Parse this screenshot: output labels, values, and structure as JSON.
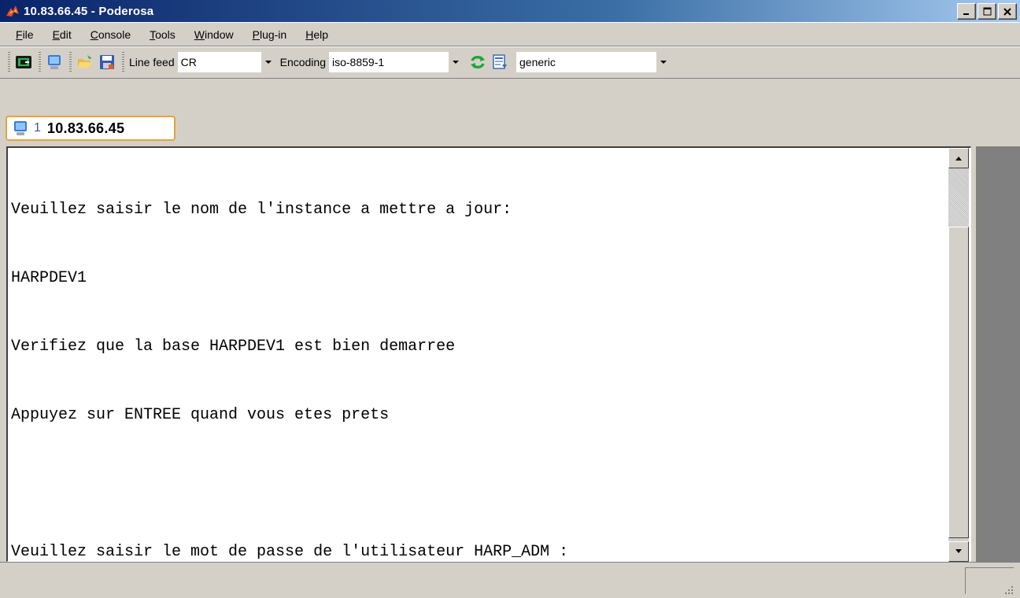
{
  "window": {
    "title": "10.83.66.45 - Poderosa",
    "app_icon": "poderosa-icon",
    "controls": [
      "minimize",
      "maximize",
      "close"
    ]
  },
  "menu": {
    "items": [
      {
        "label": "File",
        "mnemonic": "F"
      },
      {
        "label": "Edit",
        "mnemonic": "E"
      },
      {
        "label": "Console",
        "mnemonic": "C"
      },
      {
        "label": "Tools",
        "mnemonic": "T"
      },
      {
        "label": "Window",
        "mnemonic": "W"
      },
      {
        "label": "Plug-in",
        "mnemonic": "P"
      },
      {
        "label": "Help",
        "mnemonic": "H"
      }
    ]
  },
  "toolbar": {
    "line_feed_label": "Line feed",
    "line_feed_value": "CR",
    "encoding_label": "Encoding",
    "encoding_value": "iso-8859-1",
    "terminal_type_value": "generic"
  },
  "tab": {
    "number": "1",
    "host": "10.83.66.45"
  },
  "terminal": {
    "lines": [
      "Veuillez saisir le nom de l'instance a mettre a jour:",
      "HARPDEV1",
      "Verifiez que la base HARPDEV1 est bien demarree",
      "Appuyez sur ENTREE quand vous etes prets",
      "",
      "Veuillez saisir le mot de passe de l'utilisateur HARP_ADM :"
    ]
  },
  "colors": {
    "titlebar_start": "#0a246a",
    "titlebar_end": "#a6caf0",
    "tab_border": "#e8a33a",
    "face": "#d4d0c8"
  }
}
